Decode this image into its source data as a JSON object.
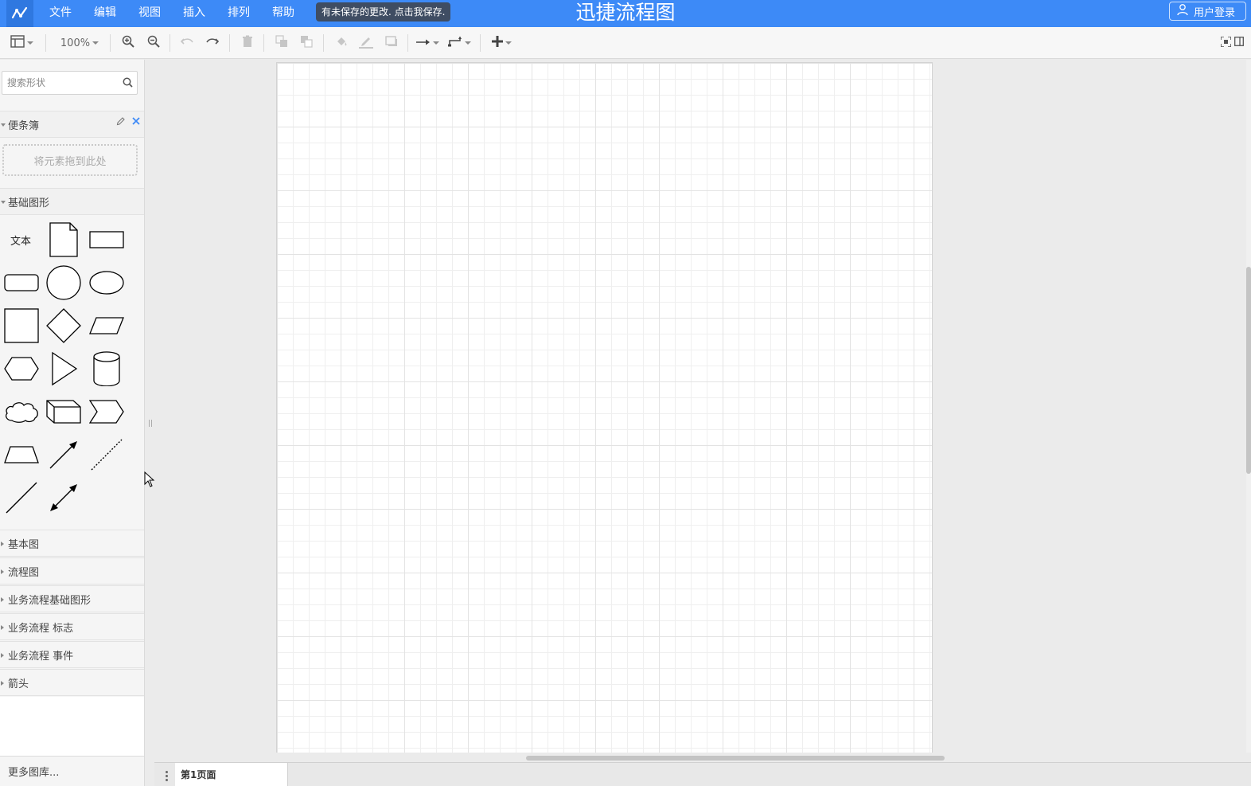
{
  "header": {
    "app_title": "迅捷流程图",
    "menu": [
      "文件",
      "编辑",
      "视图",
      "插入",
      "排列",
      "帮助"
    ],
    "save_notice": "有未保存的更改. 点击我保存.",
    "login_label": "用户登录",
    "brand_color": "#3d8af7"
  },
  "toolbar": {
    "zoom": "100%",
    "icons": [
      "layout-icon",
      "zoom-in-icon",
      "zoom-out-icon",
      "undo-icon",
      "redo-icon",
      "delete-icon",
      "to-front-icon",
      "to-back-icon",
      "fill-color-icon",
      "line-color-icon",
      "shadow-icon",
      "connection-icon",
      "waypoints-icon",
      "insert-icon",
      "fullscreen-icon",
      "format-panel-icon"
    ]
  },
  "sidebar": {
    "search_placeholder": "搜索形状",
    "scratchpad": {
      "title": "便条簿",
      "drop_hint": "将元素拖到此处"
    },
    "basic_shapes": {
      "title": "基础图形",
      "text_shape_label": "文本"
    },
    "categories": [
      "基本图",
      "流程图",
      "业务流程基础图形",
      "业务流程 标志",
      "业务流程 事件",
      "箭头"
    ],
    "more_libraries": "更多图库..."
  },
  "pages": {
    "tabs": [
      "第1页面"
    ]
  }
}
